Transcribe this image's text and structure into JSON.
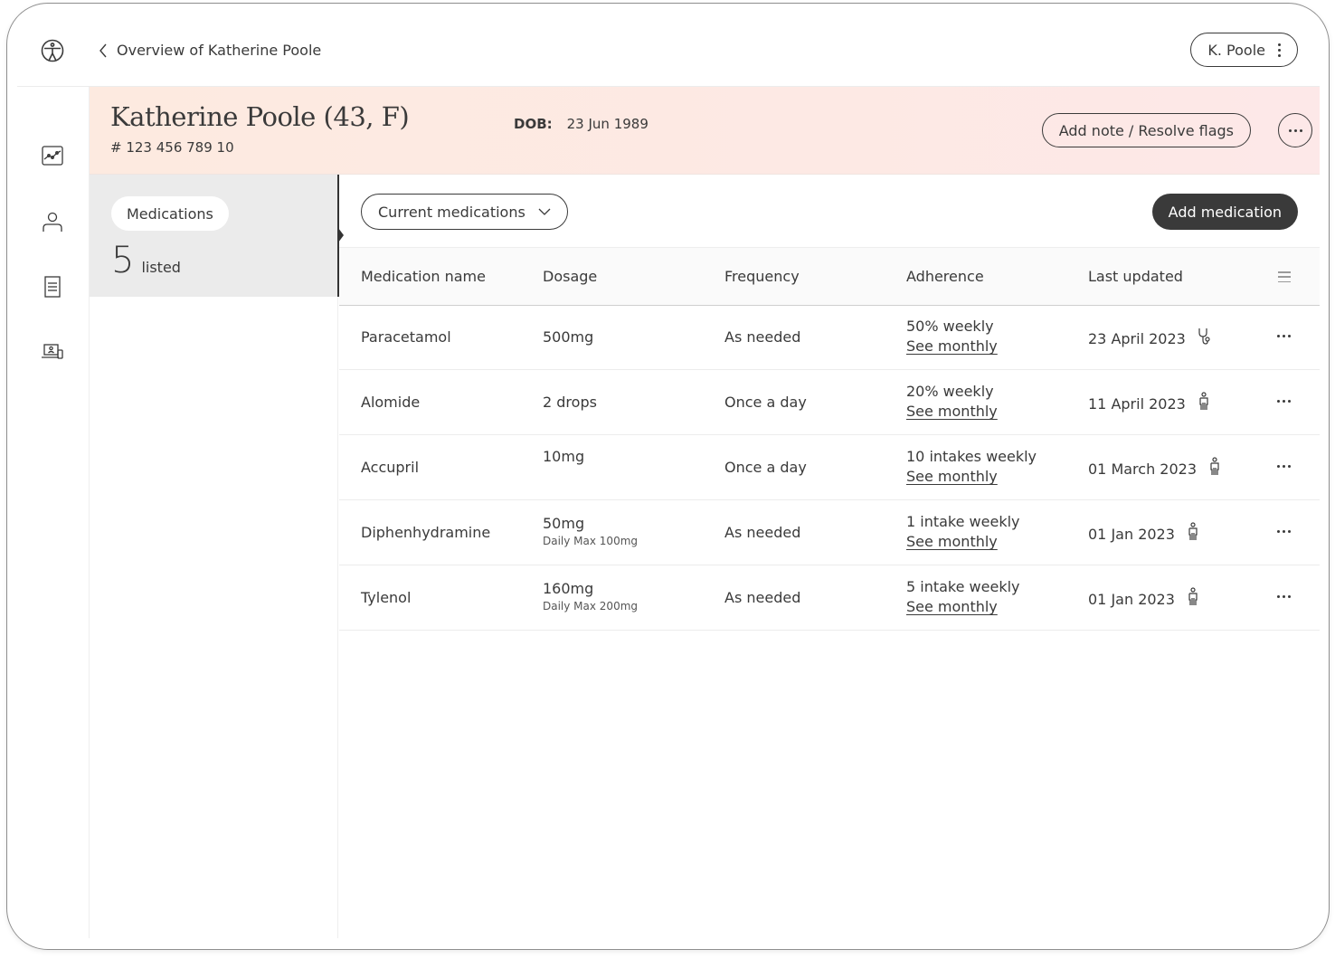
{
  "topbar": {
    "logo_icon": "accessibility-icon",
    "back_label": "Overview of Katherine Poole",
    "user_label": "K. Poole"
  },
  "rail": {
    "items": [
      {
        "name": "trends-chart-icon"
      },
      {
        "name": "profile-icon"
      },
      {
        "name": "document-list-icon"
      },
      {
        "name": "devices-icon"
      }
    ]
  },
  "patient": {
    "name": "Katherine Poole (43, F)",
    "id": "# 123 456 789 10",
    "dob_label": "DOB:",
    "dob_value": "23 Jun 1989",
    "note_button": "Add note / Resolve flags"
  },
  "panel": {
    "chip": "Medications",
    "count": "5",
    "count_label": "listed"
  },
  "main": {
    "filter_label": "Current medications",
    "add_button": "Add medication",
    "columns": [
      "Medication name",
      "Dosage",
      "Frequency",
      "Adherence",
      "Last updated"
    ],
    "rows": [
      {
        "name": "Paracetamol",
        "dosage": "500mg",
        "dosage_sub": "",
        "frequency": "As needed",
        "adherence": "50% weekly",
        "adherence_link": "See monthly",
        "updated": "23 April 2023",
        "updated_by": "stethoscope-icon"
      },
      {
        "name": "Alomide",
        "dosage": "2 drops",
        "dosage_sub": "",
        "frequency": "Once a day",
        "adherence": "20% weekly",
        "adherence_link": "See monthly",
        "updated": "11 April 2023",
        "updated_by": "patient-icon"
      },
      {
        "name": "Accupril",
        "dosage": "10mg",
        "dosage_sub": "",
        "frequency": "Once a day",
        "adherence": "10 intakes weekly",
        "adherence_link": "See monthly",
        "updated": "01 March 2023",
        "updated_by": "patient-icon"
      },
      {
        "name": "Diphenhydramine",
        "dosage": "50mg",
        "dosage_sub": "Daily Max 100mg",
        "frequency": "As needed",
        "adherence": "1 intake weekly",
        "adherence_link": "See monthly",
        "updated": "01 Jan 2023",
        "updated_by": "patient-icon"
      },
      {
        "name": "Tylenol",
        "dosage": "160mg",
        "dosage_sub": "Daily Max 200mg",
        "frequency": "As needed",
        "adherence": "5 intake weekly",
        "adherence_link": "See monthly",
        "updated": "01 Jan 2023",
        "updated_by": "patient-icon"
      }
    ]
  }
}
